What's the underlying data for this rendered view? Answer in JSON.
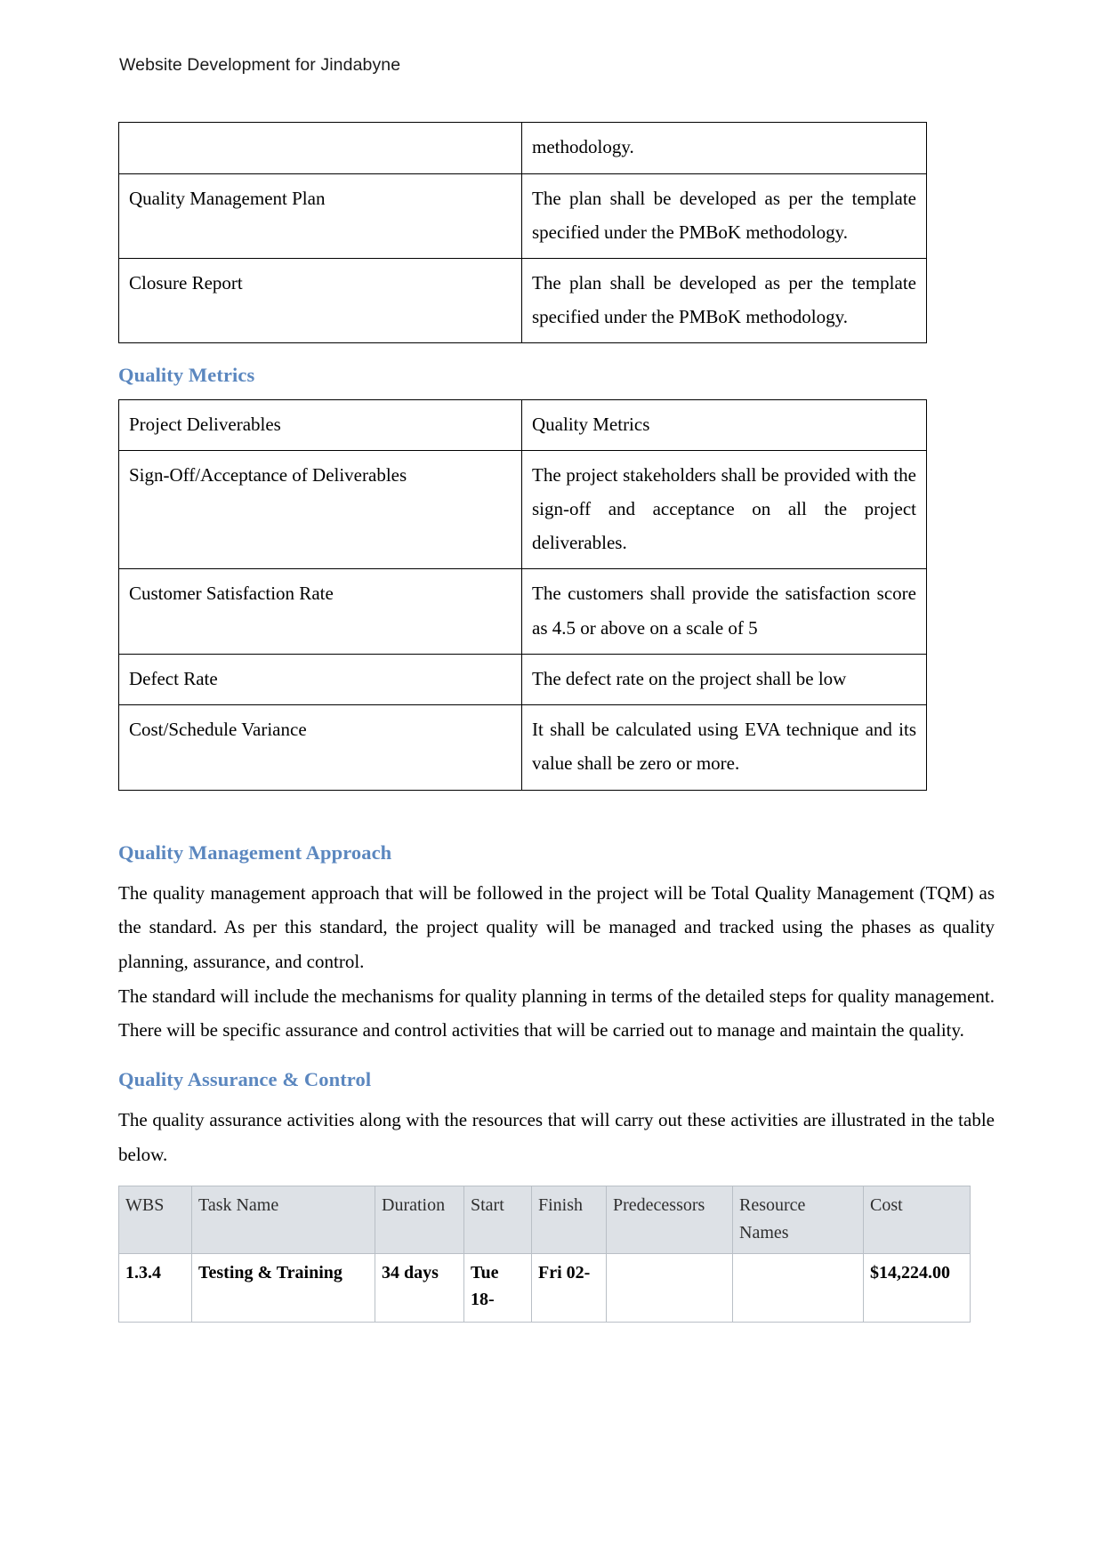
{
  "document": {
    "running_header": "Website Development for Jindabyne"
  },
  "deliverables_table": {
    "rows": [
      {
        "deliverable": "",
        "description": "methodology."
      },
      {
        "deliverable": "Quality Management Plan",
        "description": "The plan shall be developed as per the template specified under the PMBoK methodology."
      },
      {
        "deliverable": "Closure Report",
        "description": "The plan shall be developed as per the template specified under the PMBoK methodology."
      }
    ]
  },
  "quality_metrics": {
    "heading": "Quality Metrics",
    "header": {
      "col1": "Project Deliverables",
      "col2": "Quality Metrics"
    },
    "rows": [
      {
        "deliverable": "Sign-Off/Acceptance of Deliverables",
        "metric": "The project stakeholders shall be provided with the sign-off and acceptance on all the project deliverables."
      },
      {
        "deliverable": "Customer Satisfaction Rate",
        "metric": "The customers shall provide the satisfaction score as 4.5 or above on a scale of 5"
      },
      {
        "deliverable": "Defect Rate",
        "metric": "The defect rate on the project shall be low"
      },
      {
        "deliverable": "Cost/Schedule Variance",
        "metric": "It shall be calculated using EVA technique and its value shall be zero or more."
      }
    ]
  },
  "quality_management_approach": {
    "heading": "Quality Management Approach",
    "paragraph_1": "The quality management approach that will be followed in the project will be Total Quality Management (TQM) as the standard. As per this standard, the project quality will be managed and tracked using the phases as quality planning, assurance, and control.",
    "paragraph_2": "The standard will include the mechanisms for quality planning in terms of the detailed steps for quality management. There will be specific assurance and control activities that will be carried out to manage and maintain the quality."
  },
  "quality_assurance_control": {
    "heading": "Quality Assurance & Control",
    "paragraph_1": "The quality assurance activities along with the resources that will carry out these activities are illustrated in the table below.",
    "table": {
      "columns": [
        "WBS",
        "Task Name",
        "Duration",
        "Start",
        "Finish",
        "Predecessors",
        "Resource Names",
        "Cost"
      ],
      "rows": [
        {
          "wbs": "1.3.4",
          "task_name": "Testing & Training",
          "duration": "34 days",
          "start": "Tue 18-",
          "finish": "Fri 02-",
          "predecessors": "",
          "resource_names": "",
          "cost": "$14,224.00"
        }
      ]
    }
  },
  "colors": {
    "heading_blue": "#5b87bf",
    "grid_header_bg": "#dde1e6",
    "grid_border": "#b9bfc6",
    "table_border": "#000000",
    "body_text": "#000000"
  }
}
